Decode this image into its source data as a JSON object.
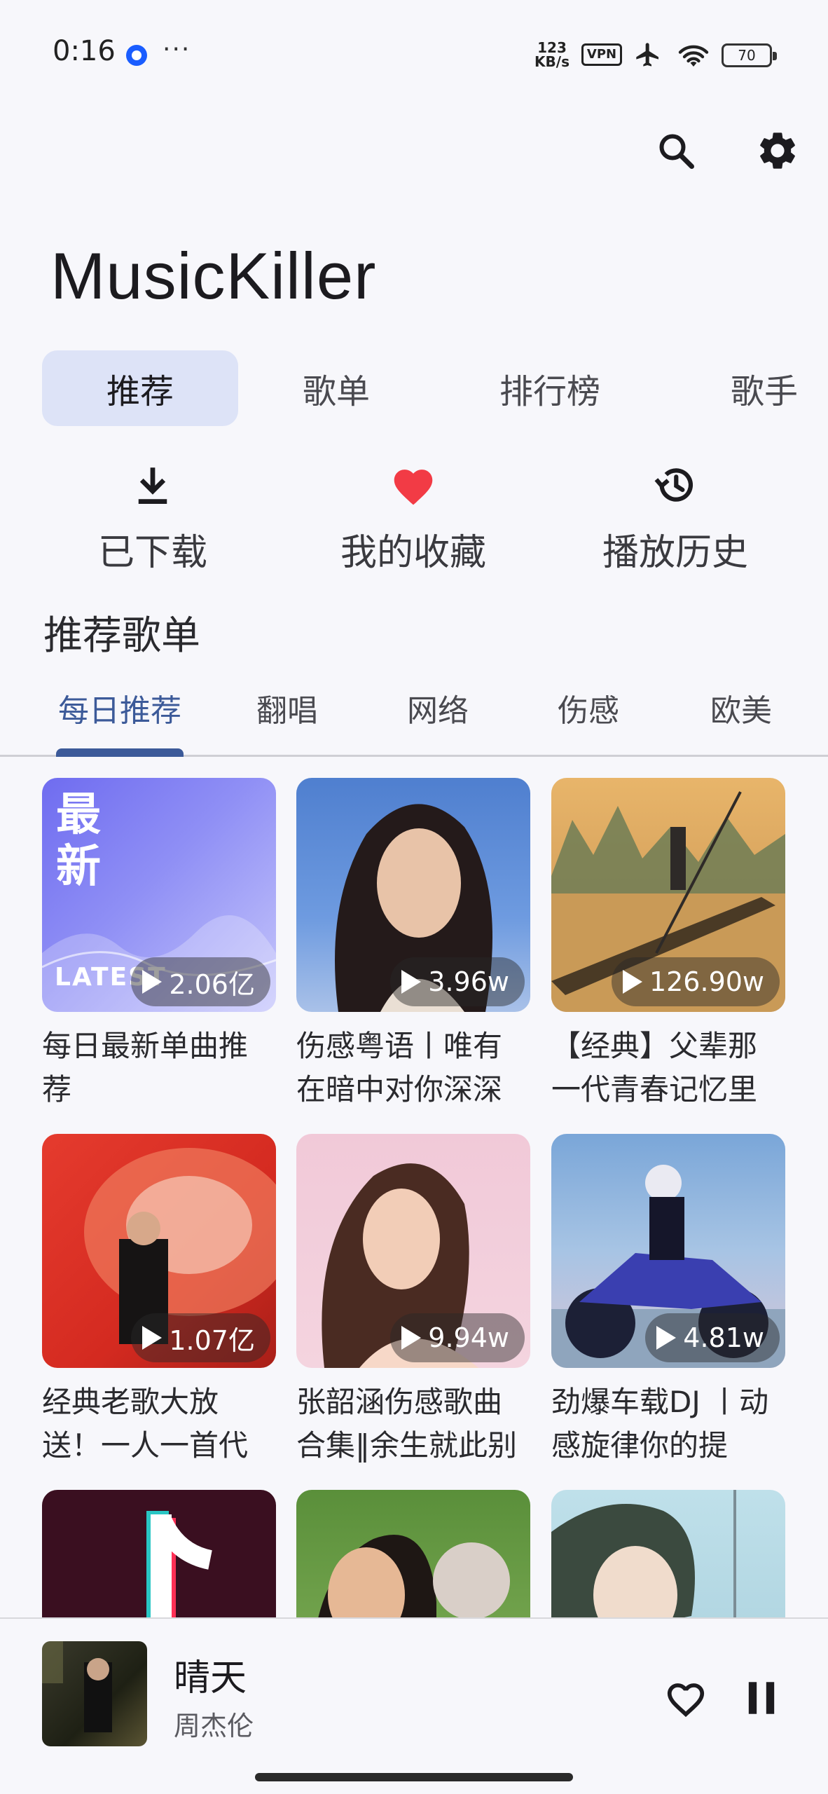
{
  "status_bar": {
    "time": "0:16",
    "more": "···",
    "net_speed_value": "123",
    "net_speed_unit": "KB/s",
    "vpn": "VPN",
    "battery": "70"
  },
  "header": {
    "title": "MusicKiller",
    "icons": [
      "search-icon",
      "gear-icon"
    ]
  },
  "main_tabs": [
    {
      "label": "推荐",
      "active": true
    },
    {
      "label": "歌单",
      "active": false
    },
    {
      "label": "排行榜",
      "active": false
    },
    {
      "label": "歌手",
      "active": false
    }
  ],
  "quick_actions": [
    {
      "label": "已下载",
      "icon": "download-icon"
    },
    {
      "label": "我的收藏",
      "icon": "heart-icon"
    },
    {
      "label": "播放历史",
      "icon": "history-icon"
    }
  ],
  "section": {
    "title": "推荐歌单"
  },
  "category_tabs": [
    {
      "label": "每日推荐",
      "active": true
    },
    {
      "label": "翻唱",
      "active": false
    },
    {
      "label": "网络",
      "active": false
    },
    {
      "label": "伤感",
      "active": false
    },
    {
      "label": "欧美",
      "active": false
    }
  ],
  "playlists": [
    {
      "title": "每日最新单曲推荐",
      "plays": "2.06亿",
      "cover_text": "最新",
      "cover_sub": "LATEST"
    },
    {
      "title": "伤感粤语丨唯有在暗中对你深深",
      "plays": "3.96w"
    },
    {
      "title": "【经典】父辈那一代青春记忆里的",
      "plays": "126.90w"
    },
    {
      "title": "经典老歌大放送！一人一首代",
      "plays": "1.07亿"
    },
    {
      "title": "张韶涵伤感歌曲合集‖余生就此别",
      "plays": "9.94w"
    },
    {
      "title": "劲爆车载DJ 丨动感旋律你的提",
      "plays": "4.81w"
    },
    {
      "title": "",
      "plays": ""
    },
    {
      "title": "",
      "plays": ""
    },
    {
      "title": "",
      "plays": ""
    }
  ],
  "player": {
    "title": "晴天",
    "artist": "周杰伦",
    "icons": [
      "heart-outline-icon",
      "pause-icon"
    ]
  },
  "colors": {
    "accent": "#3c5a99",
    "tab_active_bg": "#dde3f7",
    "background": "#f7f7fb",
    "heart": "#f23b45"
  }
}
